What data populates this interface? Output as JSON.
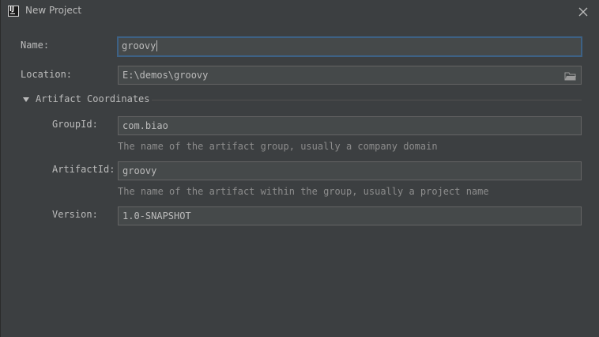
{
  "window": {
    "title": "New Project",
    "app_icon_label": "IJ"
  },
  "form": {
    "name": {
      "label": "Name:",
      "value": "groovy"
    },
    "location": {
      "label": "Location:",
      "value": "E:\\demos\\groovy"
    },
    "section": {
      "title": "Artifact Coordinates",
      "expanded": true
    },
    "group_id": {
      "label": "GroupId:",
      "value": "com.biao",
      "hint": "The name of the artifact group, usually a company domain"
    },
    "artifact_id": {
      "label": "ArtifactId:",
      "value": "groovy",
      "hint": "The name of the artifact within the group, usually a project name"
    },
    "version": {
      "label": "Version:",
      "value": "1.0-SNAPSHOT"
    }
  },
  "colors": {
    "background": "#3c3f41",
    "field_background": "#45494a",
    "field_border": "#646464",
    "focus_border": "#3d6185",
    "text": "#bbbbbb",
    "hint_text": "#8c8c8c"
  },
  "icons": {
    "app": "intellij-idea-icon",
    "close": "close-icon",
    "browse": "folder-icon",
    "expand": "triangle-down-icon"
  }
}
